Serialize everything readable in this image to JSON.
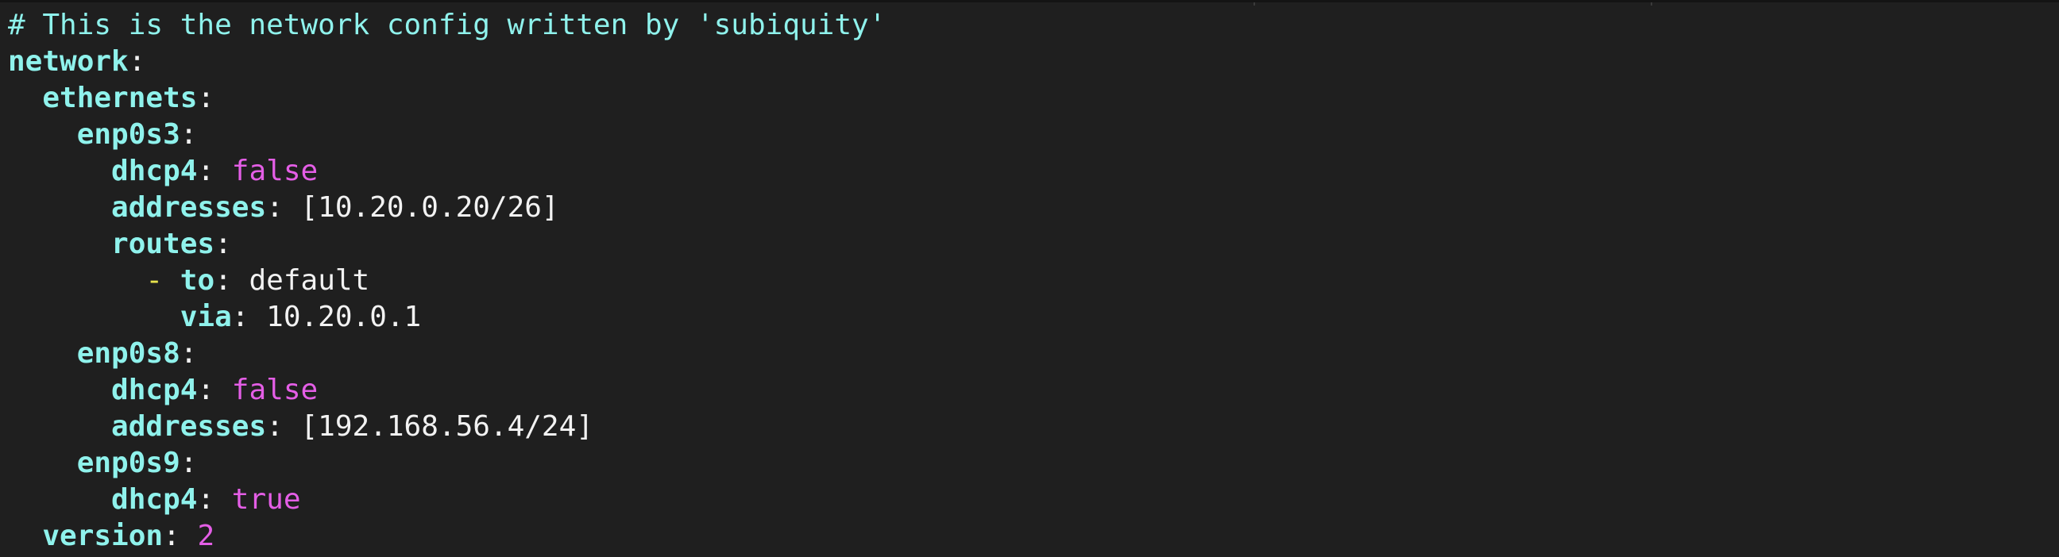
{
  "colors": {
    "background": "#1f1f1f",
    "key": "#8ff2ec",
    "comment": "#8ff2ec",
    "plain": "#f2f2f2",
    "literal": "#e45ee6",
    "list_dash": "#e7e34d"
  },
  "lines": [
    {
      "comment": "# This is the network config written by 'subiquity'"
    },
    {
      "indent": "",
      "key": "network",
      "colon": ":"
    },
    {
      "indent": "  ",
      "key": "ethernets",
      "colon": ":"
    },
    {
      "indent": "    ",
      "key": "enp0s3",
      "colon": ":"
    },
    {
      "indent": "      ",
      "key": "dhcp4",
      "colon": ":",
      "value": "false"
    },
    {
      "indent": "      ",
      "key": "addresses",
      "colon": ":",
      "value": "[10.20.0.20/26]"
    },
    {
      "indent": "      ",
      "key": "routes",
      "colon": ":"
    },
    {
      "indent": "        ",
      "dash": "-",
      "key": "to",
      "colon": ":",
      "value": "default"
    },
    {
      "indent": "          ",
      "key": "via",
      "colon": ":",
      "value": "10.20.0.1"
    },
    {
      "indent": "    ",
      "key": "enp0s8",
      "colon": ":"
    },
    {
      "indent": "      ",
      "key": "dhcp4",
      "colon": ":",
      "value": "false"
    },
    {
      "indent": "      ",
      "key": "addresses",
      "colon": ":",
      "value": "[192.168.56.4/24]"
    },
    {
      "indent": "    ",
      "key": "enp0s9",
      "colon": ":"
    },
    {
      "indent": "      ",
      "key": "dhcp4",
      "colon": ":",
      "value": "true"
    },
    {
      "indent": "  ",
      "key": "version",
      "colon": ":",
      "value": "2"
    }
  ]
}
